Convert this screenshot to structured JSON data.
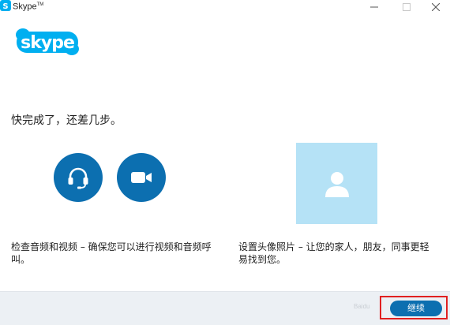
{
  "window": {
    "title": "Skype",
    "title_mark": "TM"
  },
  "logo_icon": "skype-logo",
  "heading": "快完成了，还差几步。",
  "av_section": {
    "audio_icon": "headset-icon",
    "video_icon": "video-camera-icon",
    "description": "检查音频和视频 – 确保您可以进行视频和音频呼叫。"
  },
  "profile_section": {
    "avatar_icon": "person-silhouette-icon",
    "description": "设置头像照片 – 让您的家人，朋友，同事更轻易找到您。"
  },
  "footer": {
    "continue_label": "继续",
    "watermark": "Baidu"
  },
  "colors": {
    "accent": "#0c6fb0",
    "avatar_bg": "#b5e2f6",
    "footer_bg": "#ecf0f4",
    "highlight": "#e02020",
    "logo": "#00aff0"
  }
}
